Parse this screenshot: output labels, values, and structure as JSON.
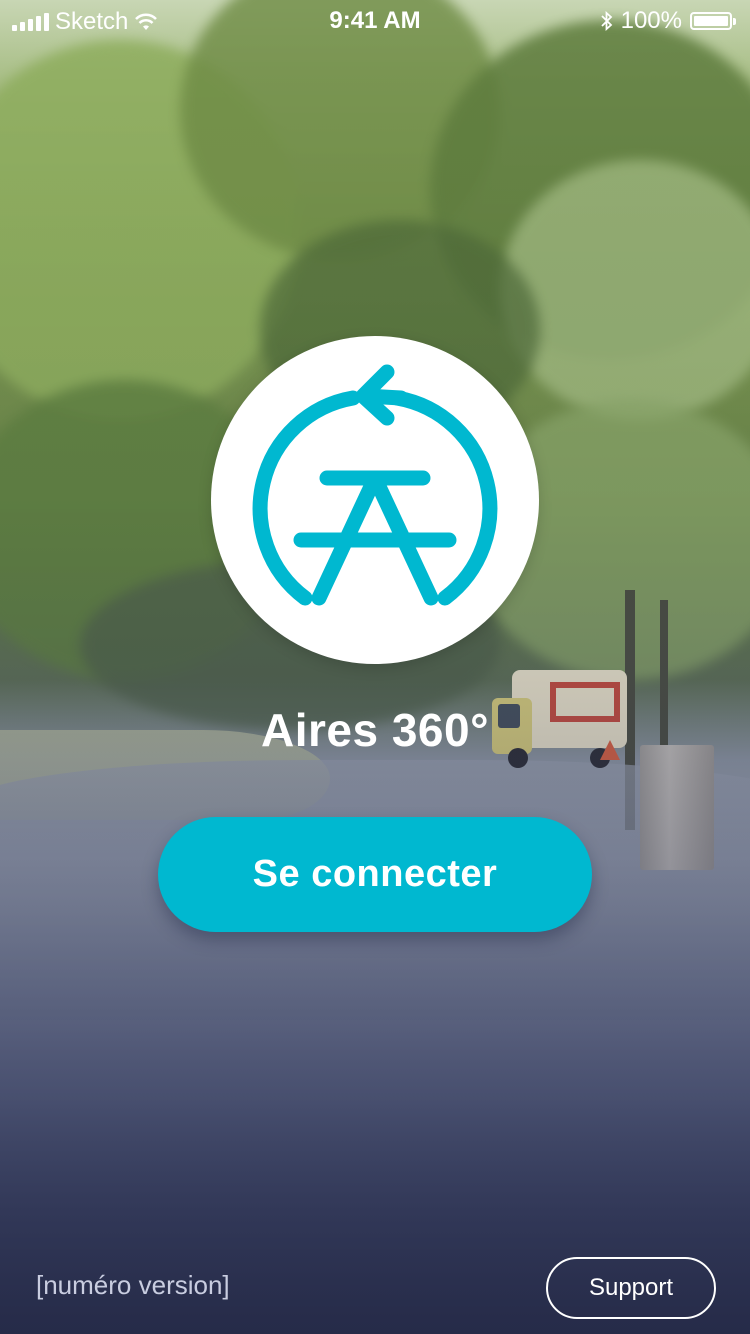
{
  "status_bar": {
    "carrier": "Sketch",
    "time": "9:41 AM",
    "battery": "100%",
    "battery_level": 1.0,
    "icons": [
      "signal-icon",
      "wifi-icon",
      "bluetooth-icon",
      "battery-icon"
    ]
  },
  "app": {
    "title": "Aires 360°",
    "logo_icon": "picnic-table-rotate-icon"
  },
  "actions": {
    "connect_label": "Se connecter",
    "support_label": "Support"
  },
  "footer": {
    "version": "[numéro version]"
  },
  "colors": {
    "accent": "#00b8d0",
    "text": "#ffffff"
  }
}
